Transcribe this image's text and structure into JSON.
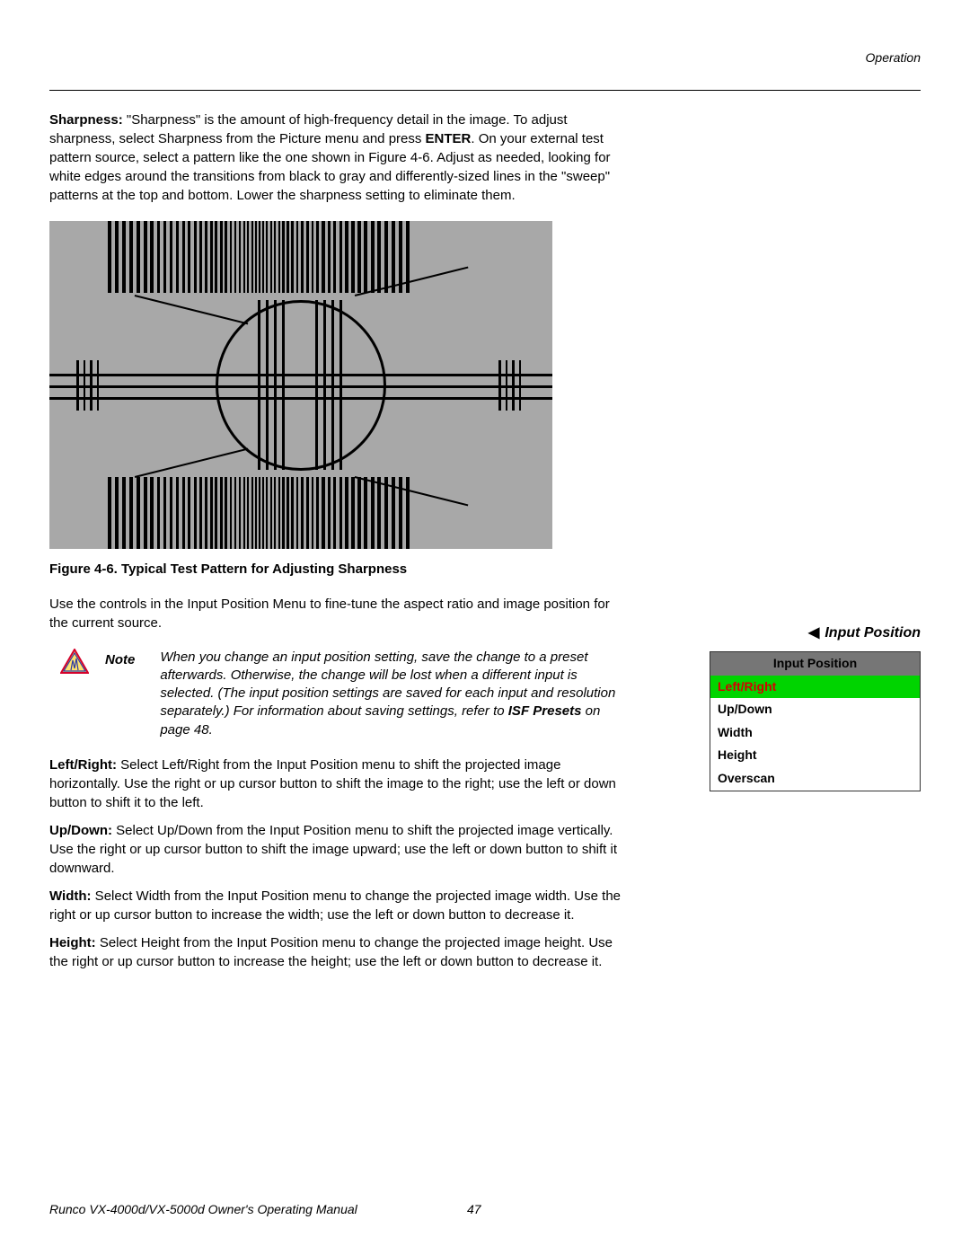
{
  "header": {
    "section": "Operation"
  },
  "sharpness": {
    "label": "Sharpness:",
    "text_a": " \"Sharpness\" is the amount of high-frequency detail in the image. To adjust sharpness, select Sharpness from the Picture menu and press ",
    "enter": "ENTER",
    "text_b": ". On your external test pattern source, select a pattern like the one shown in Figure 4-6. Adjust as needed, looking for white edges around the transitions from black to gray and differently-sized lines in the \"sweep\" patterns at the top and bottom. Lower the sharpness setting to eliminate them."
  },
  "figure": {
    "caption": "Figure 4-6. Typical Test Pattern for Adjusting Sharpness"
  },
  "input_position_intro": "Use the controls in the Input Position Menu to fine-tune the aspect ratio and image position for the current source.",
  "sidebar": {
    "arrow": "◀",
    "heading": "Input Position",
    "menu_header": "Input Position",
    "items": [
      {
        "label": "Left/Right",
        "selected": true
      },
      {
        "label": "Up/Down",
        "selected": false
      },
      {
        "label": "Width",
        "selected": false
      },
      {
        "label": "Height",
        "selected": false
      },
      {
        "label": "Overscan",
        "selected": false
      }
    ]
  },
  "note": {
    "label": "Note",
    "text_a": "When you change an input position setting, save the change to a preset afterwards. Otherwise, the change will be lost when a different input is selected. (The input position settings are saved for each input and resolution separately.) For information about saving settings, refer to ",
    "isf": "ISF Presets",
    "text_b": " on page 48."
  },
  "paragraphs": {
    "left_right": {
      "label": "Left/Right:",
      "text": " Select Left/Right from the Input Position menu to shift the projected image horizontally. Use the right or up cursor button to shift the image to the right; use the left or down button to shift it to the left."
    },
    "up_down": {
      "label": "Up/Down:",
      "text": " Select Up/Down from the Input Position menu to shift the projected image vertically. Use the right or up cursor button to shift the image upward; use the left or down button to shift it downward."
    },
    "width": {
      "label": "Width:",
      "text": " Select Width from the Input Position menu to change the projected image width. Use the right or up cursor button to increase the width; use the left or down button to decrease it."
    },
    "height": {
      "label": "Height:",
      "text": " Select Height from the Input Position menu to change the projected image height. Use the right or up cursor button to increase the height; use the left or down button to decrease it."
    }
  },
  "footer": {
    "manual": "Runco VX-4000d/VX-5000d Owner's Operating Manual",
    "page": "47"
  }
}
